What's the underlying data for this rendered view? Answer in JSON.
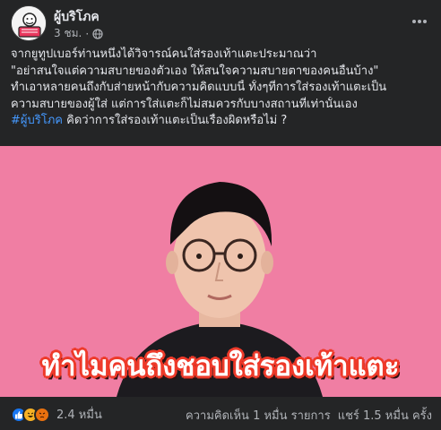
{
  "post": {
    "page_name": "ผู้บริโภค",
    "time": "3 ชม.",
    "separator": "·",
    "text_lines": [
      "จากยูทูปเบอร์ท่านหนึ่งได้วิจารณ์คนใส่รองเท้าแตะประมาณว่า",
      "\"อย่าสนใจแต่ความสบายของตัวเอง ให้สนใจความสบายตาของคนอื่นบ้าง\"",
      "ทำเอาหลายคนถึงกับส่ายหน้ากับความคิดแบบนี้ ทั้งๆที่การใส่รองเท้าแตะเป็น",
      "ความสบายของผู้ใส่ แต่การใส่แตะก็ไม่สมควรกับบางสถานที่เท่านั้นเอง"
    ],
    "hashtag": "#ผู้บริโภค",
    "last_line_rest": " คิดว่าการใส่รองเท้าแตะเป็นเรื่องผิดหรือไม่ ?",
    "video_caption": "ทำไมคนถึงชอบใส่รองเท้าแตะ"
  },
  "footer": {
    "reaction_count": "2.4 หมื่น",
    "comments": "ความคิดเห็น 1 หมื่น รายการ",
    "shares": "แชร์ 1.5 หมื่น ครั้ง"
  },
  "icons": {
    "privacy": "globe-icon",
    "more": "more-options-icon",
    "reactions": [
      "like-icon",
      "haha-icon",
      "angry-icon"
    ]
  },
  "colors": {
    "background": "#242526",
    "text": "#e4e6eb",
    "secondary_text": "#b0b3b8",
    "hashtag": "#4599ff",
    "video_background": "#f07ea3",
    "caption_outline": "#ee3a2a"
  }
}
